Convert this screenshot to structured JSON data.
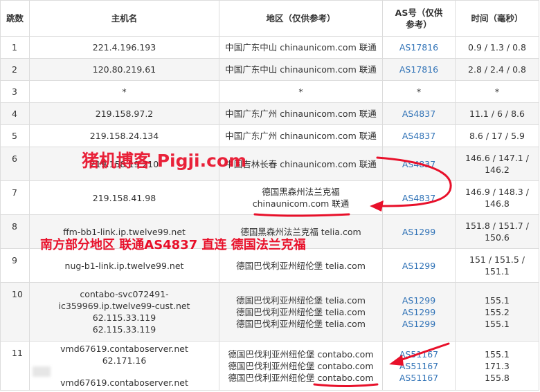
{
  "headers": {
    "hop": "跳数",
    "host": "主机名",
    "region": "地区（仅供参考）",
    "asn": "AS号（仅供参考）",
    "time": "时间（毫秒）"
  },
  "rows": [
    {
      "hop": "1",
      "host": [
        "221.4.196.193"
      ],
      "region": [
        "中国广东中山 chinaunicom.com 联通"
      ],
      "asn": [
        "AS17816"
      ],
      "time": [
        "0.9 / 1.3 / 0.8"
      ]
    },
    {
      "hop": "2",
      "host": [
        "120.80.219.61"
      ],
      "region": [
        "中国广东中山 chinaunicom.com 联通"
      ],
      "asn": [
        "AS17816"
      ],
      "time": [
        "2.8 / 2.4 / 0.8"
      ]
    },
    {
      "hop": "3",
      "host": [
        "*"
      ],
      "region": [
        "*"
      ],
      "asn": [
        "*"
      ],
      "time": [
        "*"
      ]
    },
    {
      "hop": "4",
      "host": [
        "219.158.97.2"
      ],
      "region": [
        "中国广东广州 chinaunicom.com 联通"
      ],
      "asn": [
        "AS4837"
      ],
      "time": [
        "11.1 / 6 / 8.6"
      ]
    },
    {
      "hop": "5",
      "host": [
        "219.158.24.134"
      ],
      "region": [
        "中国广东广州 chinaunicom.com 联通"
      ],
      "asn": [
        "AS4837"
      ],
      "time": [
        "8.6 / 17 / 5.9"
      ]
    },
    {
      "hop": "6",
      "host": [
        "219.158.19.210"
      ],
      "region": [
        "中国吉林长春 chinaunicom.com 联通"
      ],
      "asn": [
        "AS4837"
      ],
      "time": [
        "146.6 / 147.1 / 146.2"
      ]
    },
    {
      "hop": "7",
      "host": [
        "219.158.41.98"
      ],
      "region": [
        "德国黑森州法兰克福",
        "chinaunicom.com 联通"
      ],
      "asn": [
        "AS4837"
      ],
      "time": [
        "146.9 / 148.3 / 146.8"
      ]
    },
    {
      "hop": "8",
      "host": [
        "ffm-bb1-link.ip.twelve99.net"
      ],
      "region": [
        "德国黑森州法兰克福 telia.com"
      ],
      "asn": [
        "AS1299"
      ],
      "time": [
        "151.8 / 151.7 / 150.6"
      ]
    },
    {
      "hop": "9",
      "host": [
        "nug-b1-link.ip.twelve99.net"
      ],
      "region": [
        "德国巴伐利亚州纽伦堡 telia.com"
      ],
      "asn": [
        "AS1299"
      ],
      "time": [
        "151 / 151.5 / 151.1"
      ]
    },
    {
      "hop": "10",
      "host": [
        "contabo-svc072491-ic359969.ip.twelve99-cust.net",
        "62.115.33.119",
        "62.115.33.119"
      ],
      "region": [
        "德国巴伐利亚州纽伦堡 telia.com",
        "德国巴伐利亚州纽伦堡 telia.com",
        "德国巴伐利亚州纽伦堡 telia.com"
      ],
      "asn": [
        "AS1299",
        "AS1299",
        "AS1299"
      ],
      "time": [
        "155.1",
        "155.2",
        "155.1"
      ]
    },
    {
      "hop": "11",
      "host": [
        "vmd67619.contaboserver.net",
        "62.171.16",
        "vmd67619.contaboserver.net"
      ],
      "region": [
        "德国巴伐利亚州纽伦堡 contabo.com",
        "德国巴伐利亚州纽伦堡 contabo.com",
        "德国巴伐利亚州纽伦堡 contabo.com"
      ],
      "asn": [
        "AS51167",
        "AS51167",
        "AS51167"
      ],
      "time": [
        "155.1",
        "171.3",
        "155.8"
      ]
    }
  ],
  "watermark": "猪机博客 Pigji.com",
  "annotation": "南方部分地区 联通AS4837 直连 德国法兰克福",
  "colors": {
    "accent_red": "#e8102a",
    "link_blue": "#3173b7",
    "row_alt": "#f5f5f5",
    "border": "#dcdcdc"
  }
}
